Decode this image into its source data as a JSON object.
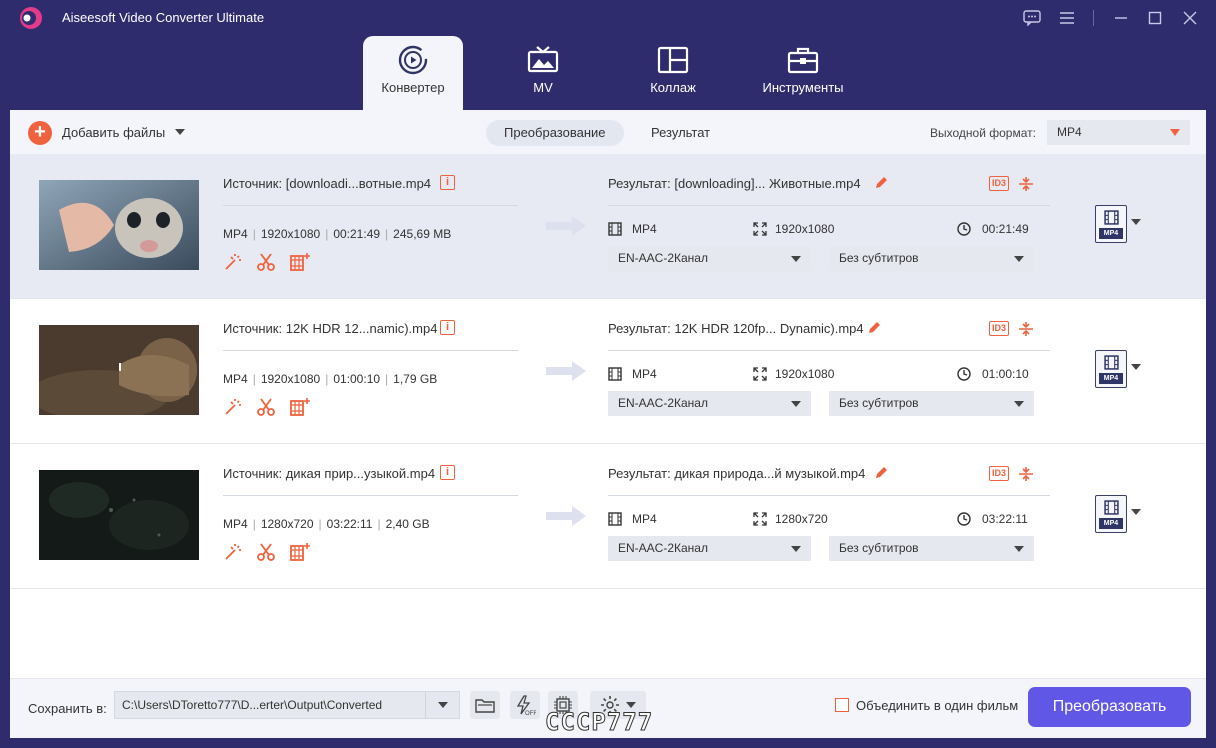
{
  "app": {
    "title": "Aiseesoft Video Converter Ultimate"
  },
  "tabs": [
    {
      "label": "Конвертер",
      "icon": "convert-icon",
      "active": true
    },
    {
      "label": "MV",
      "icon": "tv-icon",
      "active": false
    },
    {
      "label": "Коллаж",
      "icon": "collage-icon",
      "active": false
    },
    {
      "label": "Инструменты",
      "icon": "toolbox-icon",
      "active": false
    }
  ],
  "toolbar": {
    "add_files": "Добавить файлы",
    "seg_convert": "Преобразование",
    "seg_result": "Результат",
    "output_format_label": "Выходной формат:",
    "output_format_value": "MP4"
  },
  "files": [
    {
      "source": "Источник: [downloadi...вотные.mp4",
      "format": "MP4",
      "resolution": "1920x1080",
      "duration": "00:21:49",
      "size": "245,69 MB",
      "result": "Результат: [downloading]... Животные.mp4",
      "out_format": "MP4",
      "out_resolution": "1920x1080",
      "out_duration": "00:21:49",
      "audio": "EN-AAC-2Канал",
      "subtitle": "Без субтитров",
      "badge": "MP4"
    },
    {
      "source": "Источник: 12K HDR 12...namic).mp4",
      "format": "MP4",
      "resolution": "1920x1080",
      "duration": "01:00:10",
      "size": "1,79 GB",
      "result": "Результат: 12K HDR 120fp... Dynamic).mp4",
      "out_format": "MP4",
      "out_resolution": "1920x1080",
      "out_duration": "01:00:10",
      "audio": "EN-AAC-2Канал",
      "subtitle": "Без субтитров",
      "badge": "MP4"
    },
    {
      "source": "Источник: дикая прир...узыкой.mp4",
      "format": "MP4",
      "resolution": "1280x720",
      "duration": "03:22:11",
      "size": "2,40 GB",
      "result": "Результат: дикая природа...й музыкой.mp4",
      "out_format": "MP4",
      "out_resolution": "1280x720",
      "out_duration": "03:22:11",
      "audio": "EN-AAC-2Канал",
      "subtitle": "Без субтитров",
      "badge": "MP4"
    }
  ],
  "footer": {
    "save_label": "Сохранить в:",
    "path": "C:\\Users\\DToretto777\\D...erter\\Output\\Converted",
    "merge_label": "Объединить в один фильм",
    "convert_button": "Преобразовать"
  },
  "watermark": "CCCP777",
  "colors": {
    "accent": "#f0623d",
    "primary": "#6057e6",
    "header_bg": "#2f2c6e"
  }
}
